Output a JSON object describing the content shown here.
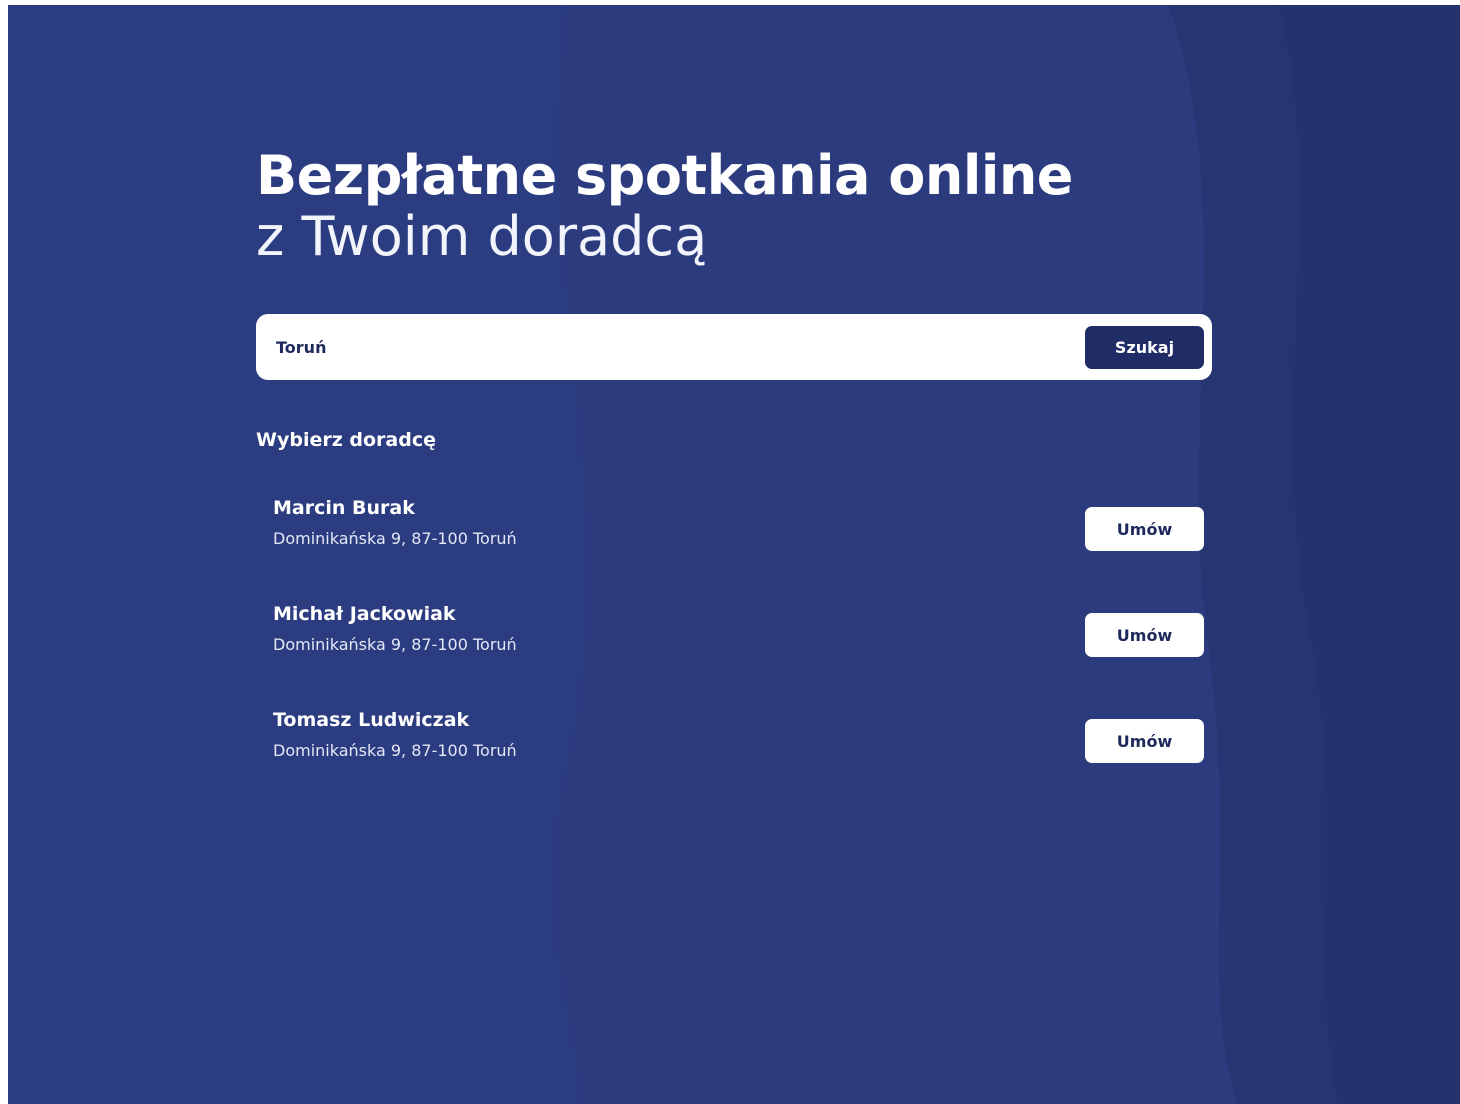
{
  "hero": {
    "title_bold": "Bezpłatne spotkania online",
    "title_light": "z Twoim doradcą"
  },
  "search": {
    "value": "Toruń",
    "button_label": "Szukaj"
  },
  "advisors_section": {
    "heading": "Wybierz doradcę",
    "advisors": [
      {
        "name": "Marcin Burak",
        "address": "Dominikańska 9, 87-100 Toruń",
        "button_label": "Umów"
      },
      {
        "name": "Michał Jackowiak",
        "address": "Dominikańska 9, 87-100 Toruń",
        "button_label": "Umów"
      },
      {
        "name": "Tomasz Ludwiczak",
        "address": "Dominikańska 9, 87-100 Toruń",
        "button_label": "Umów"
      }
    ]
  },
  "colors": {
    "background": "#2a3a7c",
    "primary_button": "#1f2c66",
    "text_on_light": "#1f2a5c",
    "white": "#ffffff"
  }
}
